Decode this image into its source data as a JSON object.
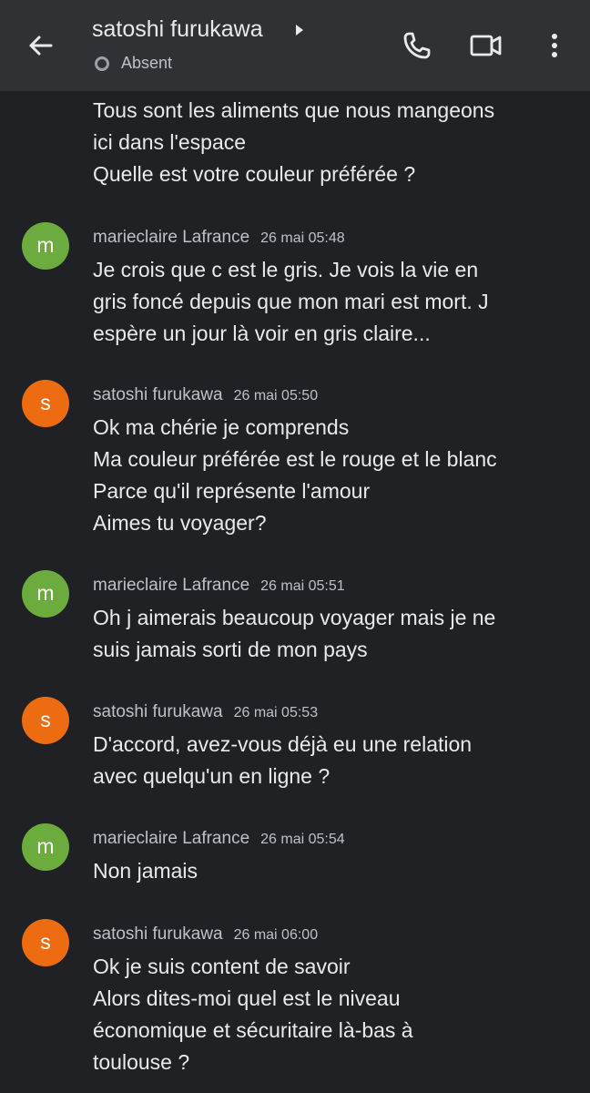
{
  "header": {
    "title": "satoshi furukawa",
    "status": "Absent"
  },
  "messages": [
    {
      "text": "Tous sont les aliments que nous mangeons\nici dans l'espace\nQuelle est votre couleur préférée ?"
    },
    {
      "avatar": "m",
      "name": "marieclaire Lafrance",
      "time": "26 mai 05:48",
      "text": "Je crois que c est le gris. Je vois la vie en\ngris foncé depuis que mon mari est mort. J\nespère un jour là voir en gris claire..."
    },
    {
      "avatar": "s",
      "name": "satoshi furukawa",
      "time": "26 mai 05:50",
      "text": "Ok ma chérie je comprends\nMa couleur préférée est le rouge et le blanc\nParce qu'il représente l'amour\nAimes tu voyager?"
    },
    {
      "avatar": "m",
      "name": "marieclaire Lafrance",
      "time": "26 mai 05:51",
      "text": "Oh j aimerais beaucoup voyager mais je ne\nsuis jamais sorti de mon pays"
    },
    {
      "avatar": "s",
      "name": "satoshi furukawa",
      "time": "26 mai 05:53",
      "text": "D'accord, avez-vous déjà eu une relation\navec quelqu'un en ligne ?"
    },
    {
      "avatar": "m",
      "name": "marieclaire Lafrance",
      "time": "26 mai 05:54",
      "text": "Non jamais"
    },
    {
      "avatar": "s",
      "name": "satoshi furukawa",
      "time": "26 mai 06:00",
      "text": "Ok je suis content de savoir\nAlors dites-moi quel est le niveau\néconomique et sécuritaire là-bas à\ntoulouse ?"
    }
  ]
}
